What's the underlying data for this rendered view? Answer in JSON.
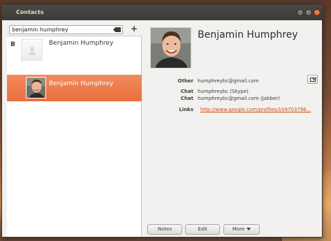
{
  "window": {
    "title": "Contacts"
  },
  "search": {
    "value": "benjamin humphrey"
  },
  "toolbar": {
    "add_label": "+"
  },
  "contact_list": {
    "group_letter": "B",
    "items": [
      {
        "name": "Benjamin Humphrey",
        "selected": false,
        "has_photo": false
      },
      {
        "name": "Benjamin Humphrey",
        "selected": true,
        "has_photo": true
      }
    ]
  },
  "details": {
    "full_name": "Benjamin Humphrey",
    "fields": [
      {
        "label": "Other",
        "value": "humphreybc@gmail.com"
      },
      {
        "label": "Chat",
        "value": "humphreybc (Skype)"
      },
      {
        "label": "Chat",
        "value": "humphreybc@gmail.com (Jabber)"
      },
      {
        "label": "Links",
        "value": "http://www.google.com/profiles/104703796..."
      }
    ],
    "buttons": {
      "notes": "Notes",
      "edit": "Edit",
      "more": "More"
    }
  },
  "icons": {
    "email": "envelope-icon",
    "clear": "clear-search-icon",
    "placeholder_avatar": "person-icon"
  },
  "colors": {
    "selection": "#e9703f",
    "link": "#cc4a17",
    "titlebar": "#3c3b37"
  }
}
